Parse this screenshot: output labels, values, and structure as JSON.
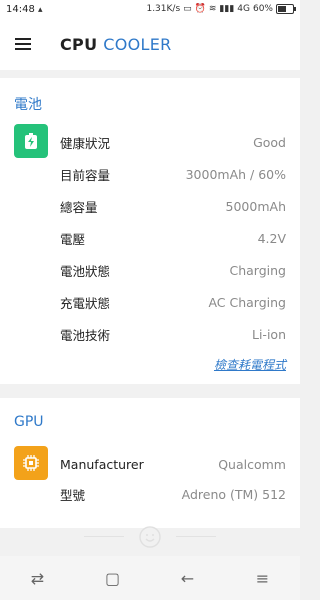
{
  "status_bar": {
    "time": "14:48",
    "network_speed": "1.31K/s",
    "signal_label": "4G",
    "battery_percent": "60%"
  },
  "app_bar": {
    "title_part1": "CPU",
    "title_part2": "COOLER"
  },
  "battery_section": {
    "title": "電池",
    "rows": [
      {
        "label": "健康狀況",
        "value": "Good"
      },
      {
        "label": "目前容量",
        "value": "3000mAh / 60%"
      },
      {
        "label": "總容量",
        "value": "5000mAh"
      },
      {
        "label": "電壓",
        "value": "4.2V"
      },
      {
        "label": "電池狀態",
        "value": "Charging"
      },
      {
        "label": "充電狀態",
        "value": "AC Charging"
      },
      {
        "label": "電池技術",
        "value": "Li-ion"
      }
    ],
    "link": "檢查耗電程式"
  },
  "gpu_section": {
    "title": "GPU",
    "rows": [
      {
        "label": "Manufacturer",
        "value": "Qualcomm"
      },
      {
        "label": "型號",
        "value": "Adreno (TM) 512"
      }
    ]
  },
  "colors": {
    "accent": "#2f79c9",
    "battery_icon_bg": "#25c27a",
    "gpu_icon_bg": "#f3a21a"
  },
  "icons": {
    "menu": "hamburger-menu-icon",
    "battery": "battery-charging-icon",
    "gpu": "chip-icon",
    "nav_back": "back-arrow-icon",
    "nav_home": "square-home-icon",
    "nav_switch": "switch-arrows-icon"
  }
}
